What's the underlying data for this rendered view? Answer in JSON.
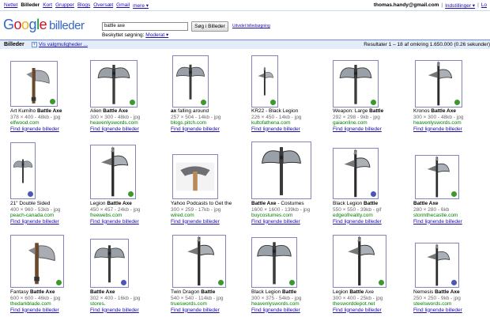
{
  "topnav": [
    {
      "label": "Nettet",
      "active": false
    },
    {
      "label": "Billeder",
      "active": true
    },
    {
      "label": "Kort",
      "active": false
    },
    {
      "label": "Grupper",
      "active": false
    },
    {
      "label": "Blogs",
      "active": false
    },
    {
      "label": "Oversæt",
      "active": false
    },
    {
      "label": "Gmail",
      "active": false
    },
    {
      "label": "mere ▾",
      "active": false
    }
  ],
  "user": {
    "email": "thomas.handy@gmail.com",
    "sep1": "|",
    "settings": "Indstillinger ▾",
    "sep2": "|",
    "logout": "Lo"
  },
  "logo": {
    "service": "billeder"
  },
  "search": {
    "query": "battle axe",
    "button": "Søg i Billeder",
    "advanced": "Udvidet billedsøgning"
  },
  "safesearch": {
    "label": "Beskyttet søgning:",
    "value": "Moderat ▾"
  },
  "results_bar": {
    "label": "Billeder",
    "options": "Vis valgmuligheder ...",
    "stats": "Resultater 1 – 18 af omkring 1.650.000 (0.26 sekunder)"
  },
  "colors": {
    "badge_green": "#3b9a2a",
    "badge_blue": "#4a56b8",
    "link": "#1a0dab",
    "site": "#008000"
  },
  "results": [
    {
      "title_pre": "Art Kumiho ",
      "title_bold": "Battle Axe",
      "title_post": "",
      "meta": "378 × 400 - 48kb - jpg",
      "site": "elfwood.com",
      "similar": "Find lignende billeder",
      "badge": "green",
      "icon": "single-axe-icon"
    },
    {
      "title_pre": "Alien ",
      "title_bold": "Battle Axe",
      "title_post": "",
      "meta": "300 × 300 - 48kb - jpg",
      "site": "heavenlyswords.com",
      "similar": "Find lignende billeder",
      "badge": "green",
      "icon": "double-axe-icon"
    },
    {
      "title_pre": "",
      "title_bold": "ax",
      "title_post": " falling around",
      "meta": "257 × 504 - 14kb - jpg",
      "site": "blogs.pitch.com",
      "similar": "Find lignende billeder",
      "badge": "green",
      "icon": "double-axe-icon"
    },
    {
      "title_pre": "KR22 - Black Legion",
      "title_bold": "",
      "title_post": "",
      "meta": "226 × 450 - 14kb - jpg",
      "site": "kultofathena.com",
      "similar": "Find lignende billeder",
      "badge": "green",
      "icon": "poleaxe-icon"
    },
    {
      "title_pre": "Weapon: Large ",
      "title_bold": "Battle",
      "title_post": "",
      "meta": "292 × 298 - 9kb - jpg",
      "site": "gaiaonline.com",
      "similar": "Find lignende billeder",
      "badge": "green",
      "icon": "double-axe-icon"
    },
    {
      "title_pre": "Kronos ",
      "title_bold": "Battle Axe",
      "title_post": "",
      "meta": "300 × 300 - 48kb - jpg",
      "site": "heavenlyswords.com",
      "similar": "Find lignende billeder",
      "badge": "green",
      "icon": "poleaxe-icon"
    },
    {
      "title_pre": "21\" Double Sided",
      "title_bold": "",
      "title_post": "",
      "meta": "400 × 960 - 53kb - jpg",
      "site": "peach-canada.com",
      "similar": "Find lignende billeder",
      "badge": "blue",
      "icon": "double-axe-icon"
    },
    {
      "title_pre": "Legion ",
      "title_bold": "Battle Axe",
      "title_post": "",
      "meta": "450 × 457 - 24kb - jpg",
      "site": "freewebs.com",
      "similar": "Find lignende billeder",
      "badge": "green",
      "icon": "poleaxe-icon"
    },
    {
      "title_pre": "Yahoo Podcasts to Get the",
      "title_bold": "",
      "title_post": "",
      "meta": "300 × 259 - 17kb - jpg",
      "site": "wired.com",
      "similar": "Find lignende billeder",
      "badge": "",
      "icon": "wood-axe-icon"
    },
    {
      "title_pre": "",
      "title_bold": "Battle Axe",
      "title_post": " - Costumes",
      "meta": "1600 × 1600 - 139kb - jpg",
      "site": "buycostumes.com",
      "similar": "Find lignende billeder",
      "badge": "",
      "icon": "double-axe-icon"
    },
    {
      "title_pre": "Black Legion ",
      "title_bold": "Battle",
      "title_post": "",
      "meta": "550 × 550 - 39kb - gif",
      "site": "edgeofreality.com",
      "similar": "Find lignende billeder",
      "badge": "blue",
      "icon": "poleaxe-icon"
    },
    {
      "title_pre": "",
      "title_bold": "Battle Axe",
      "title_post": "",
      "meta": "280 × 280 - 6kb",
      "site": "stormthecastle.com",
      "similar": "Find lignende billeder",
      "badge": "green",
      "icon": "poleaxe-icon"
    },
    {
      "title_pre": "Fantasy ",
      "title_bold": "Battle Axe",
      "title_post": "",
      "meta": "600 × 600 - 46kb - jpg",
      "site": "thedarkblade.com",
      "similar": "Find lignende billeder",
      "badge": "green",
      "icon": "single-axe-icon"
    },
    {
      "title_pre": "",
      "title_bold": "Battle Axe",
      "title_post": "",
      "meta": "302 × 400 - 16kb - jpg",
      "site": "stores.",
      "similar": "Find lignende billeder",
      "badge": "blue",
      "icon": "double-axe-icon"
    },
    {
      "title_pre": "Twin Dragon ",
      "title_bold": "Battle",
      "title_post": "",
      "meta": "540 × 540 - 114kb - jpg",
      "site": "trueswords.com",
      "similar": "Find lignende billeder",
      "badge": "green",
      "icon": "poleaxe-icon"
    },
    {
      "title_pre": "Black Legion ",
      "title_bold": "Battle",
      "title_post": "",
      "meta": "300 × 375 - 54kb - jpg",
      "site": "heavenlyswords.com",
      "similar": "Find lignende billeder",
      "badge": "green",
      "icon": "double-axe-icon"
    },
    {
      "title_pre": "Legion ",
      "title_bold": "Battle",
      "title_post": " Axe",
      "meta": "300 × 400 - 25kb - jpg",
      "site": "thesworddepot.net",
      "similar": "Find lignende billeder",
      "badge": "green",
      "icon": "poleaxe-icon"
    },
    {
      "title_pre": "Nemesis ",
      "title_bold": "Battle Axe",
      "title_post": "",
      "meta": "250 × 250 - 9kb - jpg",
      "site": "steelswords.com",
      "similar": "Find lignende billeder",
      "badge": "blue",
      "icon": "poleaxe-icon"
    }
  ]
}
